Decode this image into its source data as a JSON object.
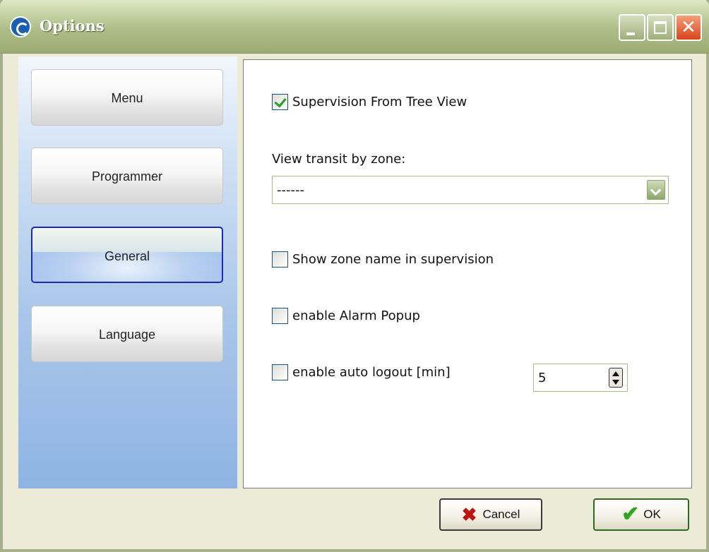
{
  "window": {
    "title": "Options",
    "close_glyph": "✕"
  },
  "sidebar": {
    "items": [
      {
        "label": "Menu",
        "active": false
      },
      {
        "label": "Programmer",
        "active": false
      },
      {
        "label": "General",
        "active": true
      },
      {
        "label": "Language",
        "active": false
      }
    ]
  },
  "general": {
    "supervision_tree_view": {
      "label": "Supervision From Tree View",
      "checked": true
    },
    "view_transit_label": "View transit by zone:",
    "view_transit_value": "------",
    "show_zone_name": {
      "label": "Show zone name in supervision",
      "checked": false
    },
    "alarm_popup": {
      "label": "enable Alarm Popup",
      "checked": false
    },
    "auto_logout": {
      "label": "enable auto logout [min]",
      "checked": false,
      "minutes": "5"
    }
  },
  "footer": {
    "cancel_label": "Cancel",
    "ok_label": "OK",
    "cancel_icon": "✖",
    "ok_icon": "✔"
  },
  "colors": {
    "titlebar": "#aebd88",
    "sidebar_bottom": "#8fb4e3",
    "active_border": "#1c2bb5",
    "check_green": "#21a121",
    "cancel_red": "#c01010"
  }
}
